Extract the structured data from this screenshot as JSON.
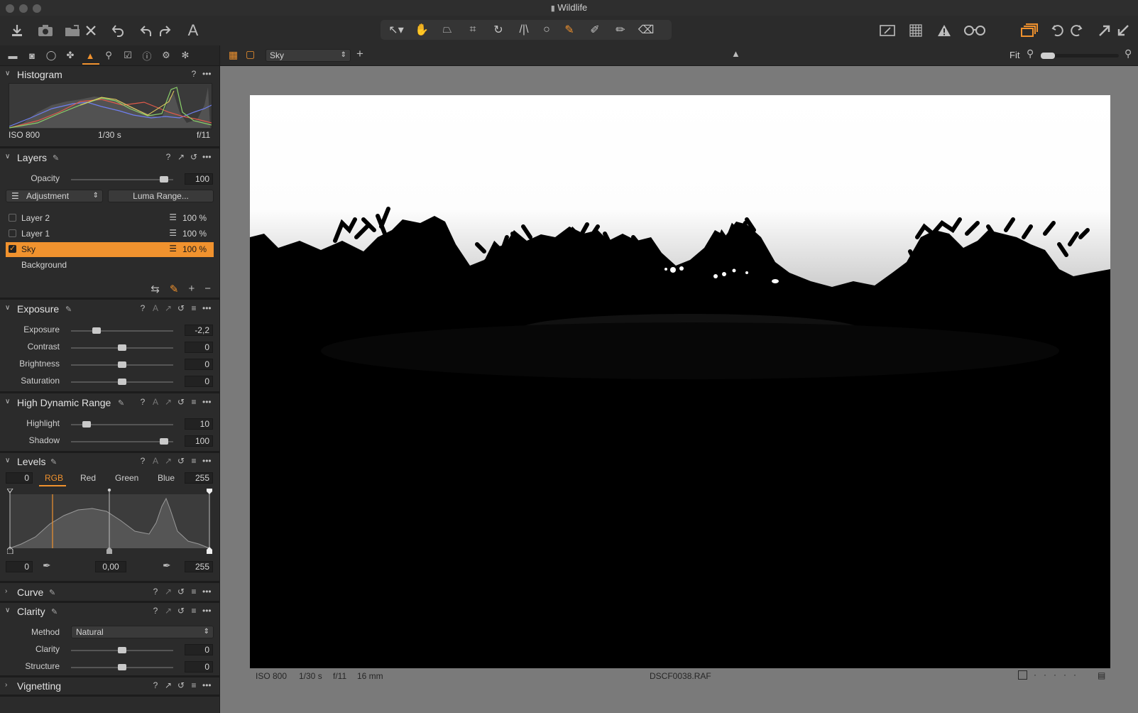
{
  "window": {
    "title": "Wildlife"
  },
  "toolbar": {
    "left_icons": [
      "import-icon",
      "camera-icon",
      "export-icon",
      "delete-icon",
      "undo-all-icon",
      "undo-icon",
      "redo-icon",
      "text-icon"
    ],
    "tools": [
      "select-cursor-icon",
      "pan-hand-icon",
      "keystone-icon",
      "crop-icon",
      "rotate-icon",
      "straighten-icon",
      "circle-icon",
      "brush-icon",
      "gradient-brush-icon",
      "draw-mask-icon",
      "eraser-icon"
    ],
    "right_icons": [
      "edit-mask-icon",
      "grid-icon",
      "warning-icon",
      "proof-glasses-icon",
      "variants-icon",
      "rotate-left-icon",
      "rotate-right-icon",
      "expand-icon",
      "collapse-icon"
    ],
    "accent": "#f0922e"
  },
  "tool_tabs": [
    "library-icon",
    "capture-icon",
    "lens-icon",
    "color-icon",
    "exposure-tab-icon",
    "details-icon",
    "adjustments-icon",
    "metadata-icon",
    "output-icon",
    "batch-icon"
  ],
  "histogram": {
    "title": "Histogram",
    "iso": "ISO 800",
    "shutter": "1/30 s",
    "aperture": "f/11"
  },
  "layers": {
    "title": "Layers",
    "opacity_label": "Opacity",
    "opacity_value": "100",
    "opacity_level": 0.95,
    "adjustment_label": "Adjustment",
    "luma_button": "Luma Range...",
    "items": [
      {
        "name": "Layer 2",
        "opacity": "100 %",
        "checked": false,
        "selected": false
      },
      {
        "name": "Layer 1",
        "opacity": "100 %",
        "checked": false,
        "selected": false
      },
      {
        "name": "Sky",
        "opacity": "100 %",
        "checked": true,
        "selected": true
      },
      {
        "name": "Background",
        "opacity": "",
        "checked": false,
        "selected": false
      }
    ]
  },
  "exposure": {
    "title": "Exposure",
    "rows": [
      {
        "label": "Exposure",
        "value": "-2,2",
        "level": 0.23
      },
      {
        "label": "Contrast",
        "value": "0",
        "level": 0.5
      },
      {
        "label": "Brightness",
        "value": "0",
        "level": 0.5
      },
      {
        "label": "Saturation",
        "value": "0",
        "level": 0.5
      }
    ]
  },
  "hdr": {
    "title": "High Dynamic Range",
    "rows": [
      {
        "label": "Highlight",
        "value": "10",
        "level": 0.12
      },
      {
        "label": "Shadow",
        "value": "100",
        "level": 0.95
      }
    ]
  },
  "levels": {
    "title": "Levels",
    "input_low": "0",
    "input_high": "255",
    "tabs": [
      "RGB",
      "Red",
      "Green",
      "Blue"
    ],
    "active_tab": "RGB",
    "output_low": "0",
    "midpoint": "0,00",
    "output_high": "255"
  },
  "curve": {
    "title": "Curve"
  },
  "clarity": {
    "title": "Clarity",
    "method_label": "Method",
    "method_value": "Natural",
    "rows": [
      {
        "label": "Clarity",
        "value": "0",
        "level": 0.5
      },
      {
        "label": "Structure",
        "value": "0",
        "level": 0.5
      }
    ]
  },
  "vignetting": {
    "title": "Vignetting"
  },
  "viewer": {
    "layer_select": "Sky",
    "fit_label": "Fit",
    "status": {
      "iso": "ISO 800",
      "shutter": "1/30 s",
      "aperture": "f/11",
      "focal": "16 mm",
      "filename": "DSCF0038.RAF"
    }
  }
}
